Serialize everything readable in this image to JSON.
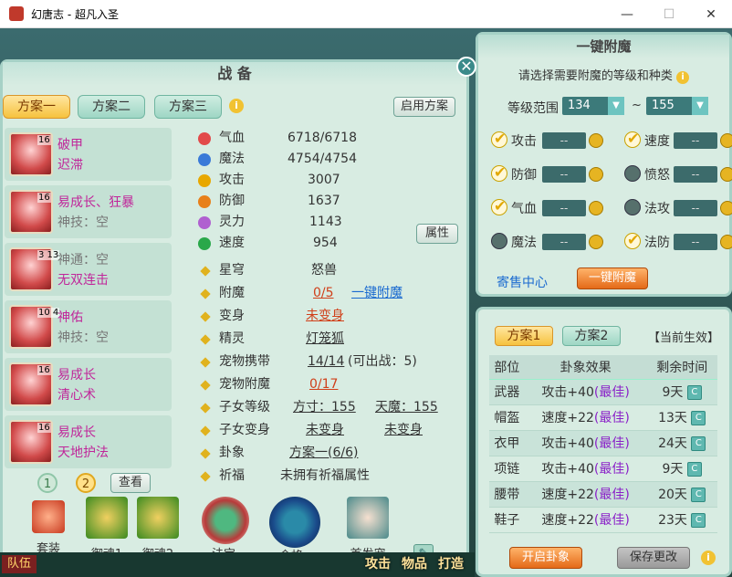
{
  "window": {
    "title": "幻唐志 - 超凡入圣",
    "min": "—",
    "max": "☐",
    "close": "✕"
  },
  "left": {
    "title": "战 备",
    "close": "✕",
    "tabs": [
      "方案一",
      "方案二",
      "方案三"
    ],
    "apply_btn": "启用方案",
    "info": "i",
    "pets": [
      {
        "level": "16",
        "line1": "破甲",
        "line2": "迟滞",
        "line1_color": "magenta",
        "line2_color": "magenta"
      },
      {
        "level": "16",
        "line1": "易成长、狂暴",
        "line2": "神技：空",
        "line1_color": "magenta",
        "line2_color": "grey"
      },
      {
        "level": "3 13",
        "line1": "神通：空",
        "line2": "无双连击",
        "line1_color": "grey",
        "line2_color": "magenta"
      },
      {
        "level": "10 4",
        "line1": "神佑",
        "line2": "神技：空",
        "line1_color": "magenta",
        "line2_color": "grey"
      },
      {
        "level": "16",
        "line1": "易成长",
        "line2": "清心术",
        "line1_color": "magenta",
        "line2_color": "magenta"
      },
      {
        "level": "16",
        "line1": "易成长",
        "line2": "天地护法",
        "line1_color": "magenta",
        "line2_color": "magenta"
      }
    ],
    "pages": [
      "1",
      "2"
    ],
    "view_btn": "查看",
    "stats": [
      {
        "label": "气血",
        "value": "6718/6718",
        "color": "#e24a4a"
      },
      {
        "label": "魔法",
        "value": "4754/4754",
        "color": "#3a7ad8"
      },
      {
        "label": "攻击",
        "value": "3007",
        "color": "#e8a800"
      },
      {
        "label": "防御",
        "value": "1637",
        "color": "#e8801a"
      },
      {
        "label": "灵力",
        "value": "1143",
        "color": "#b060d0"
      },
      {
        "label": "速度",
        "value": "954",
        "color": "#2aa84a"
      }
    ],
    "attr_btn": "属性",
    "fields": {
      "star_label": "星穹",
      "star_value": "怒兽",
      "enchant_label": "附魔",
      "enchant_value": "0/5",
      "enchant_link": "一键附魔",
      "transform_label": "变身",
      "transform_value": "未变身",
      "spirit_label": "精灵",
      "spirit_value": "灯笼狐",
      "pet_carry_label": "宠物携带",
      "pet_carry_value": "14/14",
      "pet_carry_extra": "(可出战：5)",
      "pet_enchant_label": "宠物附魔",
      "pet_enchant_value": "0/17",
      "child_level_label": "子女等级",
      "child_level_a": "方寸：155",
      "child_level_b": "天魔：155",
      "child_transform_label": "子女变身",
      "child_transform_a": "未变身",
      "child_transform_b": "未变身",
      "gua_label": "卦象",
      "gua_value": "方案一(6/6)",
      "blessing_label": "祈福",
      "blessing_value": "未拥有祈福属性"
    },
    "bottom": [
      {
        "name": "套装",
        "color": "#c83a20"
      },
      {
        "name": "御魂1",
        "color": "#3a8a20"
      },
      {
        "name": "御魂2",
        "color": "#3a8a20"
      },
      {
        "name": "法宝",
        "color": "#b83a3a"
      },
      {
        "name": "命格",
        "color": "#1a4a8a"
      },
      {
        "name": "首发宠",
        "color": "#4a8a8a"
      }
    ],
    "edit": "✎"
  },
  "enchant": {
    "title": "一键附魔",
    "prompt": "请选择需要附魔的等级和种类",
    "range_label": "等级范围",
    "range_min": "134",
    "range_sep": "~",
    "range_max": "155",
    "options": [
      {
        "label": "攻击",
        "checked": true,
        "value": "--"
      },
      {
        "label": "速度",
        "checked": true,
        "value": "--"
      },
      {
        "label": "防御",
        "checked": true,
        "value": "--"
      },
      {
        "label": "愤怒",
        "checked": false,
        "value": "--"
      },
      {
        "label": "气血",
        "checked": true,
        "value": "--"
      },
      {
        "label": "法攻",
        "checked": false,
        "value": "--"
      },
      {
        "label": "魔法",
        "checked": false,
        "value": "--"
      },
      {
        "label": "法防",
        "checked": true,
        "value": "--"
      }
    ],
    "shop_link": "寄售中心",
    "enchant_btn": "一键附魔"
  },
  "gua": {
    "tabs": [
      "方案1",
      "方案2"
    ],
    "current": "【当前生效】",
    "headers": [
      "部位",
      "卦象效果",
      "剩余时间"
    ],
    "rows": [
      {
        "part": "武器",
        "effect": "攻击+40",
        "tag": "(最佳)",
        "time": "9天"
      },
      {
        "part": "帽盔",
        "effect": "速度+22",
        "tag": "(最佳)",
        "time": "13天"
      },
      {
        "part": "衣甲",
        "effect": "攻击+40",
        "tag": "(最佳)",
        "time": "24天"
      },
      {
        "part": "项链",
        "effect": "攻击+40",
        "tag": "(最佳)",
        "time": "9天"
      },
      {
        "part": "腰带",
        "effect": "速度+22",
        "tag": "(最佳)",
        "time": "20天"
      },
      {
        "part": "鞋子",
        "effect": "速度+22",
        "tag": "(最佳)",
        "time": "23天"
      }
    ],
    "open_btn": "开启卦象",
    "save_btn": "保存更改"
  },
  "taskbar": {
    "team": "队伍",
    "actions": [
      "攻击",
      "物品",
      "打造"
    ]
  }
}
